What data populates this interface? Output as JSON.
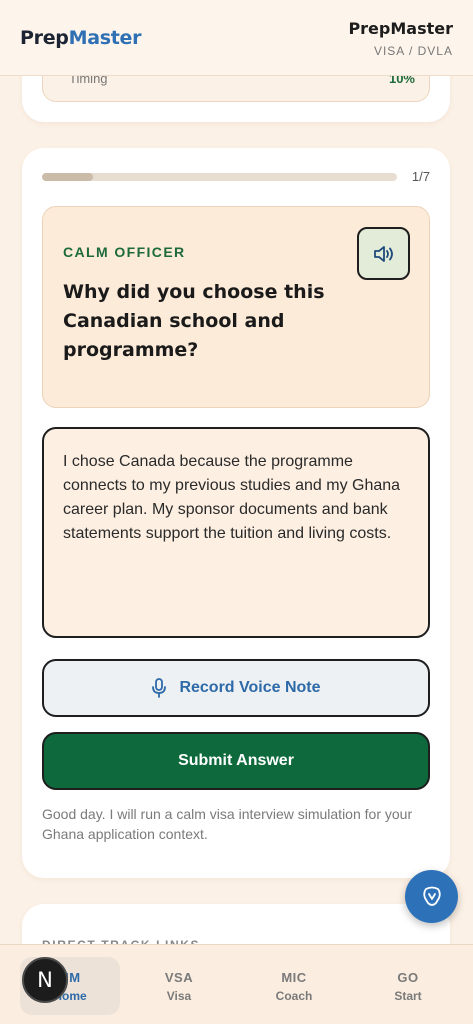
{
  "header": {
    "brand_part1": "Prep",
    "brand_part2": "Master",
    "title": "PrepMaster",
    "subtitle": "VISA / DVLA"
  },
  "timing": {
    "label": "Timing",
    "value": "10%"
  },
  "progress": {
    "current": 1,
    "total": 7,
    "label": "1/7"
  },
  "question": {
    "officer": "CALM OFFICER",
    "text": "Why did you choose this Canadian school and programme?",
    "speaker_icon": "speaker-icon"
  },
  "answer": {
    "value": "I chose Canada because the programme connects to my previous studies and my Ghana career plan. My sponsor documents and bank statements support the tuition and living costs."
  },
  "actions": {
    "record_label": "Record Voice Note",
    "record_icon": "microphone-icon",
    "submit_label": "Submit Answer"
  },
  "intro": "Good day. I will run a calm visa interview simulation for your Ghana application context.",
  "next_section": "DIRECT TRACK LINKS",
  "fab_icon": "chat-coach-icon",
  "badge_letter": "N",
  "nav": {
    "items": [
      {
        "code": "HM",
        "label": "Home",
        "active": true
      },
      {
        "code": "VSA",
        "label": "Visa",
        "active": false
      },
      {
        "code": "MIC",
        "label": "Coach",
        "active": false
      },
      {
        "code": "GO",
        "label": "Start",
        "active": false
      }
    ]
  },
  "colors": {
    "accent_blue": "#2e6aa8",
    "accent_green": "#0e6a3c",
    "background": "#fcf1e6"
  }
}
